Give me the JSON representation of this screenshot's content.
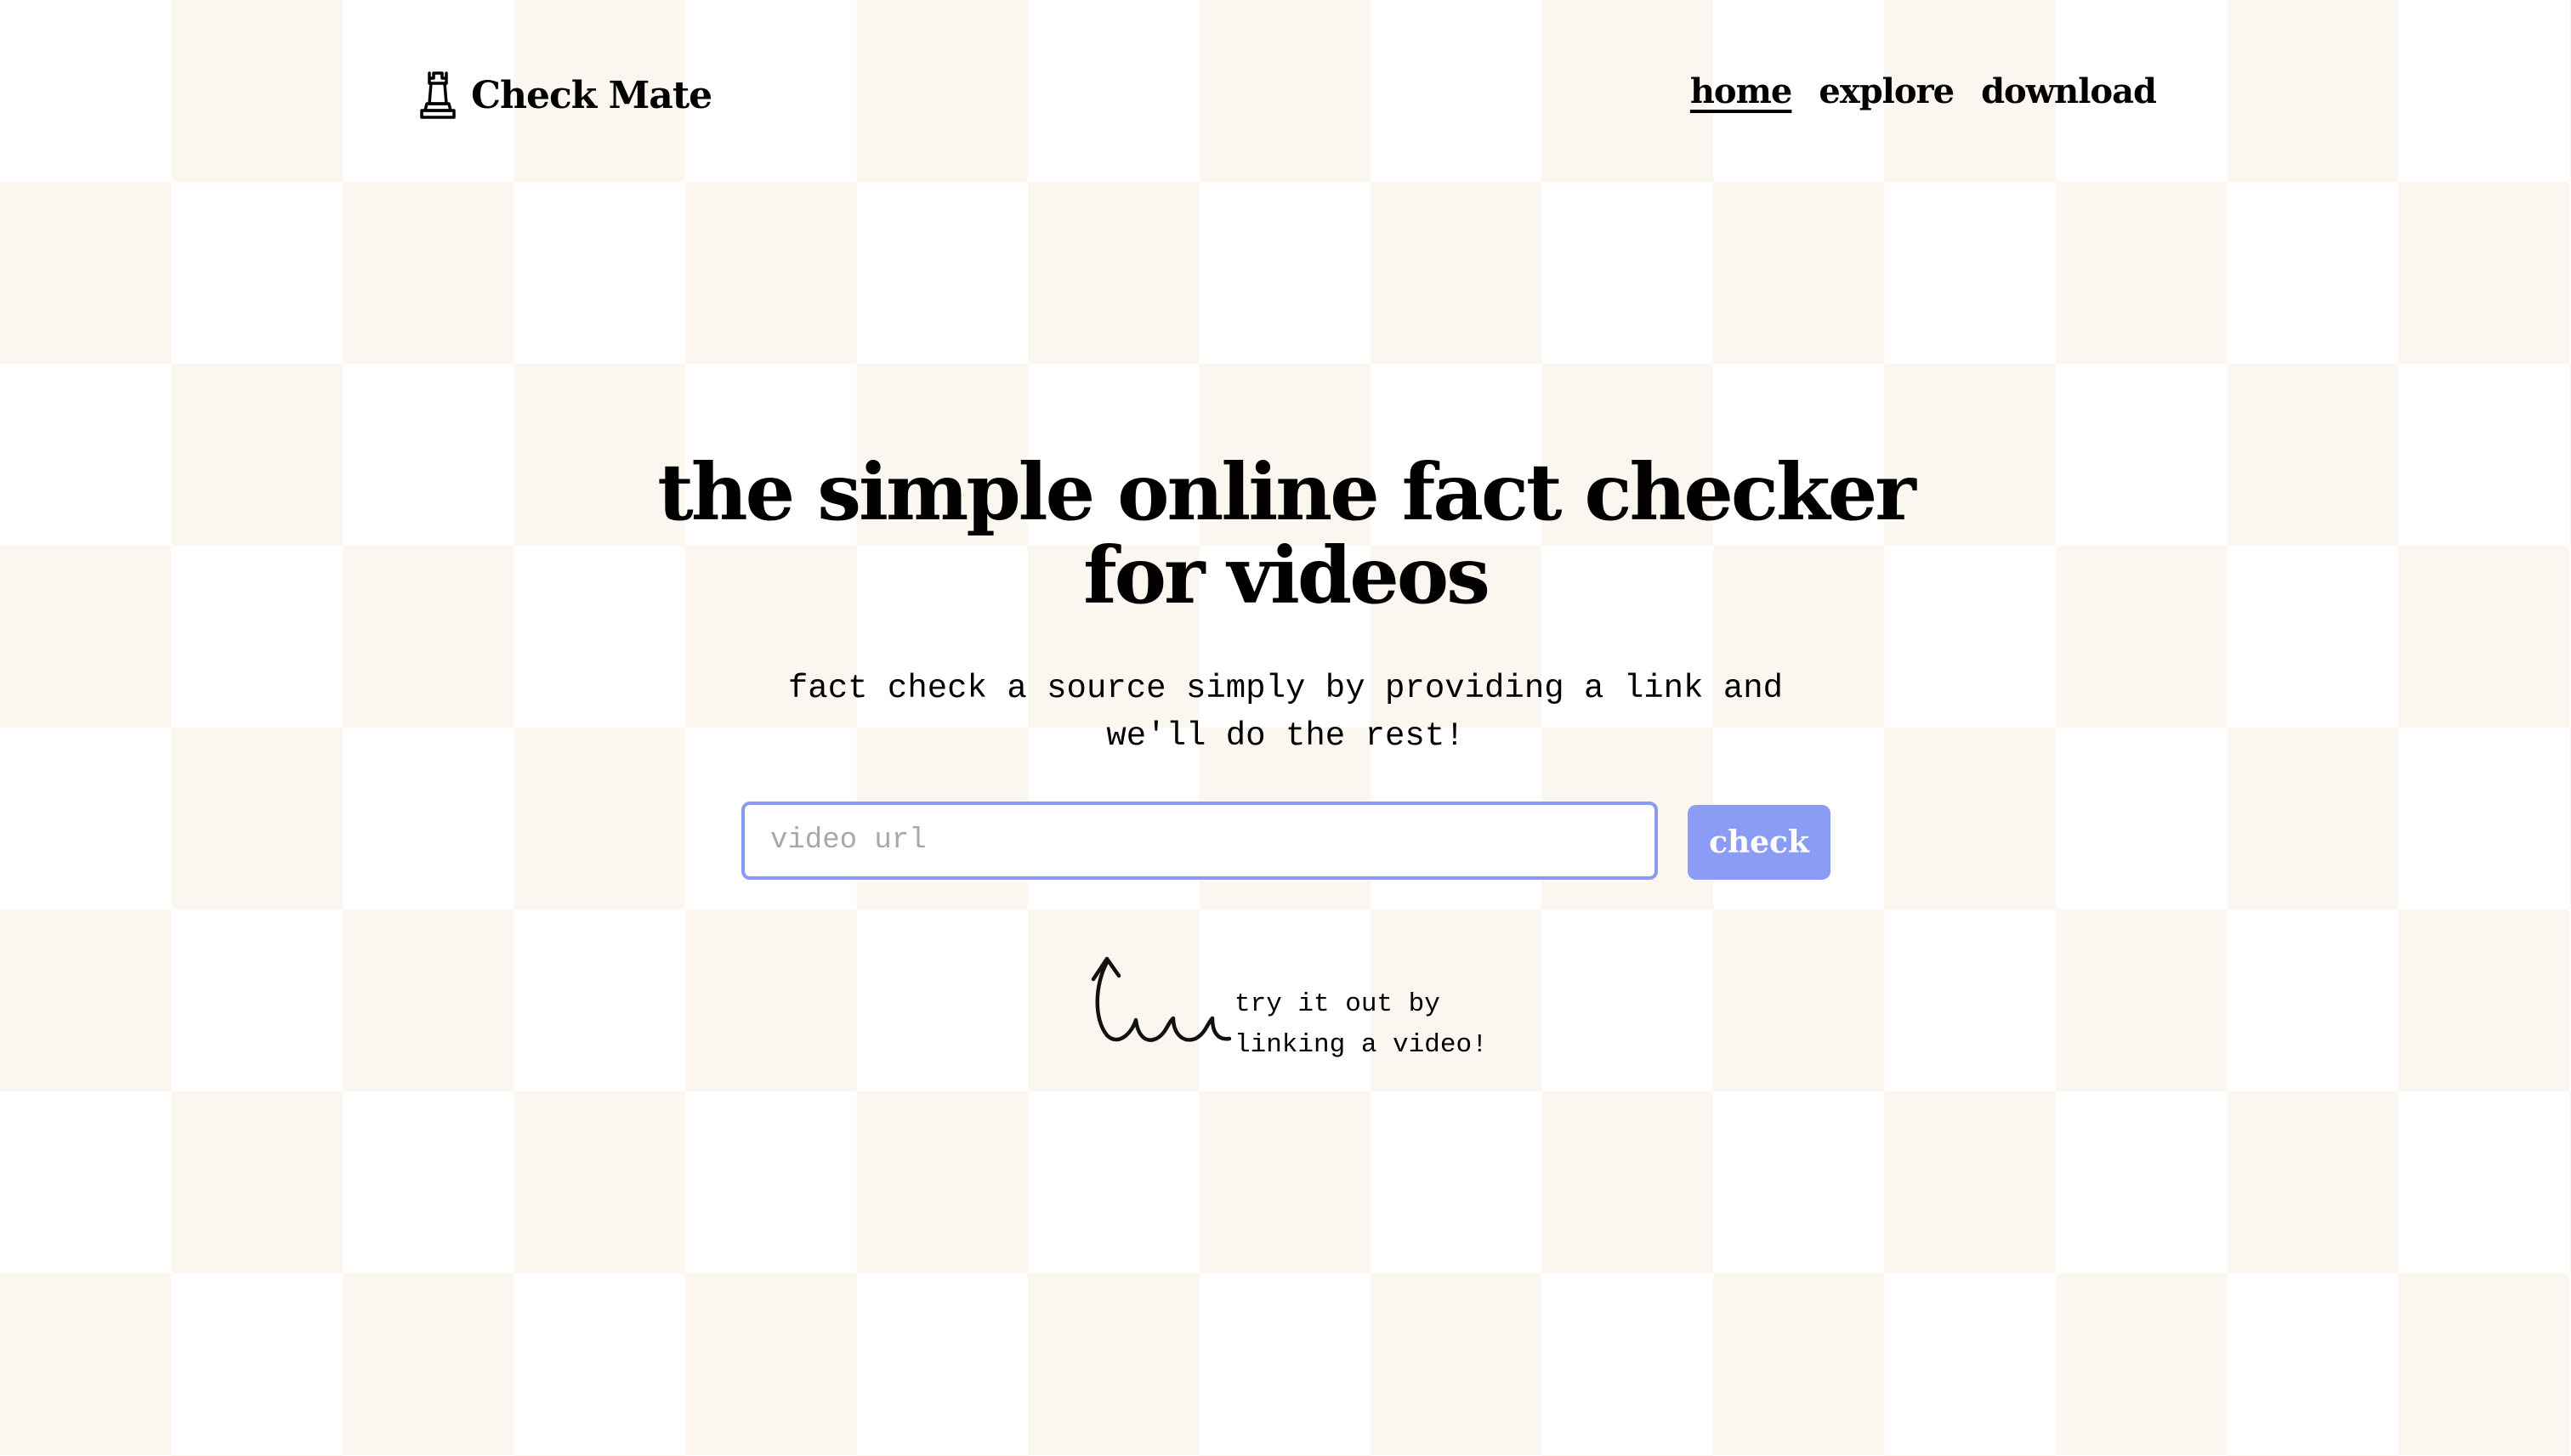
{
  "brand": {
    "name": "Check Mate",
    "icon": "chess-rook-icon"
  },
  "nav": {
    "items": [
      {
        "label": "home",
        "active": true
      },
      {
        "label": "explore",
        "active": false
      },
      {
        "label": "download",
        "active": false
      }
    ]
  },
  "hero": {
    "title_line1": "the simple online fact checker",
    "title_line2": "for videos",
    "subtitle_line1": "fact check a source simply by providing a link and",
    "subtitle_line2": "we'll do the rest!"
  },
  "form": {
    "input_value": "",
    "input_placeholder": "video url",
    "button_label": "check"
  },
  "hint": {
    "icon": "curly-arrow-icon",
    "line1": "try it out by",
    "line2": "linking a video!"
  },
  "colors": {
    "accent": "#8a9cf4",
    "input_border": "#8a9af0",
    "checker_light": "#fbf6ef",
    "background": "#ffffff"
  }
}
